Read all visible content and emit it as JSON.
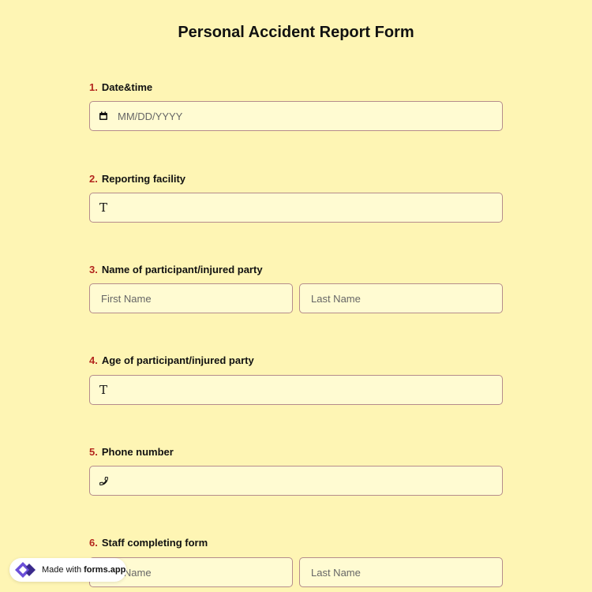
{
  "form": {
    "title": "Personal Accident Report Form"
  },
  "questions": [
    {
      "number": "1.",
      "label": "Date&time",
      "placeholder": "MM/DD/YYYY",
      "icon": "calendar-icon"
    },
    {
      "number": "2.",
      "label": "Reporting facility",
      "placeholder": "",
      "icon": "text-type-icon"
    },
    {
      "number": "3.",
      "label": "Name of participant/injured party",
      "first_placeholder": "First Name",
      "last_placeholder": "Last Name"
    },
    {
      "number": "4.",
      "label": "Age of participant/injured party",
      "placeholder": "",
      "icon": "text-type-icon"
    },
    {
      "number": "5.",
      "label": "Phone number",
      "placeholder": "",
      "icon": "phone-icon"
    },
    {
      "number": "6.",
      "label": "Staff completing form",
      "first_placeholder": "First Name",
      "last_placeholder": "Last Name"
    }
  ],
  "icons": {
    "text_glyph": "T"
  },
  "badge": {
    "made_with": "Made with",
    "brand": "forms.app",
    "icon": "forms-app-logo"
  },
  "colors": {
    "background": "#fef5b4",
    "field_background": "#fffbd2",
    "field_border": "#b58c8c",
    "number_accent": "#b3261e",
    "logo_purple": "#6b4fd8"
  }
}
